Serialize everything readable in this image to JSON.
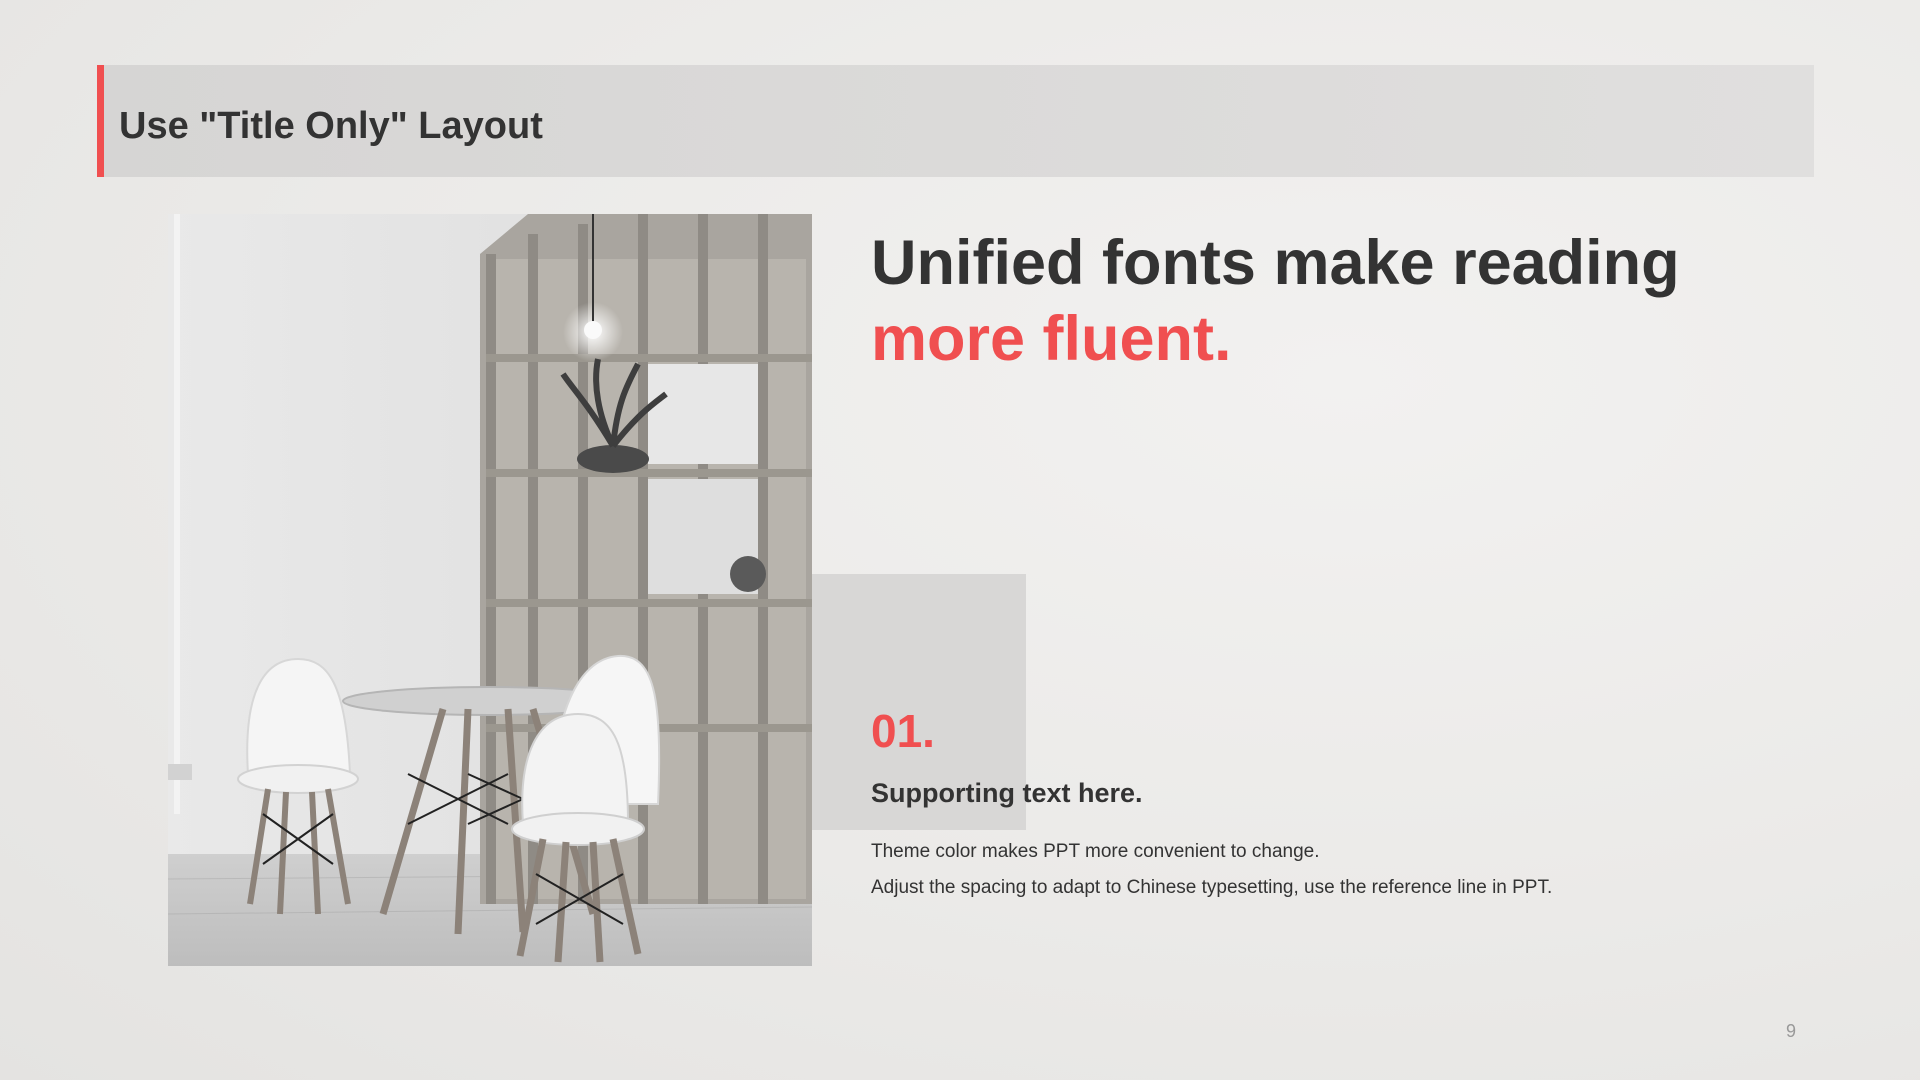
{
  "slide": {
    "title": "Use \"Title Only\" Layout",
    "headline_line1": "Unified fonts make reading",
    "headline_line2": "more fluent.",
    "number": "01.",
    "subheading": "Supporting text here.",
    "body_line1": "Theme color makes PPT more convenient  to change.",
    "body_line2": "Adjust  the spacing  to adapt to Chinese  typesetting, use the reference line  in PPT.",
    "page_number": "9"
  },
  "colors": {
    "accent": "#f04f50",
    "text": "#333333",
    "title_bar": "#d9d8d7",
    "panel": "#d8d7d6"
  }
}
